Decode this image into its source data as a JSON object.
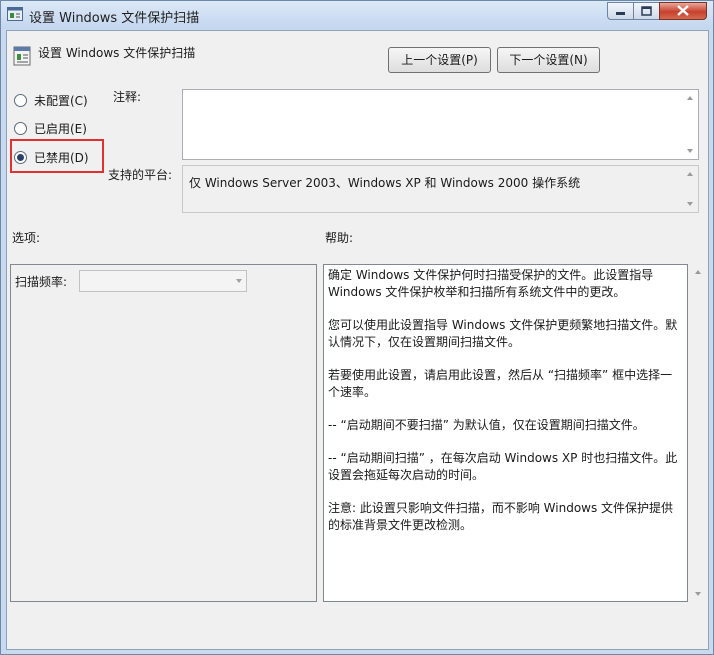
{
  "window": {
    "title": "设置 Windows 文件保护扫描"
  },
  "header": {
    "setting_name": "设置 Windows 文件保护扫描",
    "prev_button": "上一个设置(P)",
    "next_button": "下一个设置(N)"
  },
  "state": {
    "options": [
      {
        "label": "未配置(C)",
        "checked": false
      },
      {
        "label": "已启用(E)",
        "checked": false
      },
      {
        "label": "已禁用(D)",
        "checked": true
      }
    ]
  },
  "comment": {
    "label": "注释:",
    "value": ""
  },
  "platform": {
    "label": "支持的平台:",
    "value": "仅 Windows Server 2003、Windows XP 和 Windows 2000 操作系统"
  },
  "options_section": {
    "label": "选项:",
    "scan_frequency_label": "扫描频率:",
    "scan_frequency_value": ""
  },
  "help_section": {
    "label": "帮助:",
    "paragraphs": [
      "确定 Windows 文件保护何时扫描受保护的文件。此设置指导 Windows 文件保护枚举和扫描所有系统文件中的更改。",
      "您可以使用此设置指导 Windows 文件保护更频繁地扫描文件。默认情况下，仅在设置期间扫描文件。",
      "若要使用此设置，请启用此设置，然后从 “扫描频率” 框中选择一个速率。",
      "-- “启动期间不要扫描” 为默认值，仅在设置期间扫描文件。",
      "-- “启动期间扫描” ，在每次启动 Windows XP 时也扫描文件。此设置会拖延每次启动的时间。",
      "注意: 此设置只影响文件扫描，而不影响 Windows 文件保护提供的标准背景文件更改检测。"
    ]
  },
  "colors": {
    "highlight": "#e03030",
    "titlebar": "#c9daee"
  }
}
